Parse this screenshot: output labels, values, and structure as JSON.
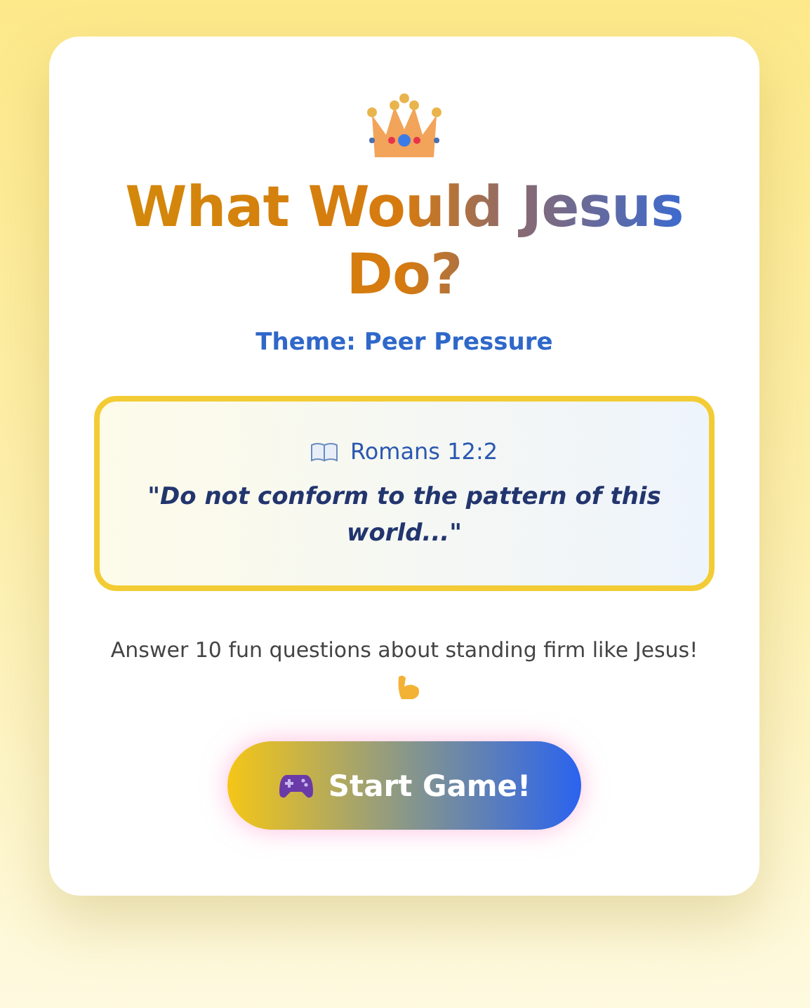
{
  "title": "What Would Jesus Do?",
  "theme": "Theme: Peer Pressure",
  "verse": {
    "reference": "Romans 12:2",
    "quote": "\"Do not conform to the pattern of this world...\""
  },
  "description": "Answer 10 fun questions about standing firm like Jesus!",
  "start_button": {
    "label": "Start Game!"
  }
}
